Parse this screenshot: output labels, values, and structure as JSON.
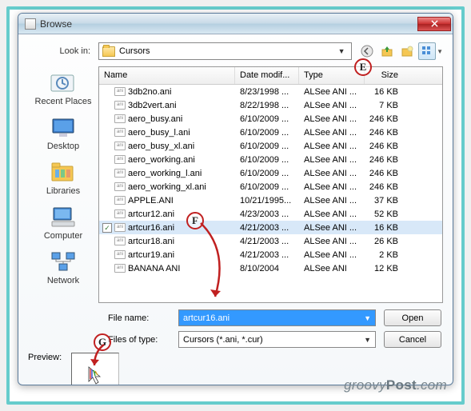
{
  "window": {
    "title": "Browse"
  },
  "lookin": {
    "label": "Look in:",
    "folder": "Cursors"
  },
  "columns": {
    "name": "Name",
    "date": "Date modif...",
    "type": "Type",
    "size": "Size"
  },
  "places": [
    {
      "id": "recent",
      "label": "Recent Places"
    },
    {
      "id": "desktop",
      "label": "Desktop"
    },
    {
      "id": "libraries",
      "label": "Libraries"
    },
    {
      "id": "computer",
      "label": "Computer"
    },
    {
      "id": "network",
      "label": "Network"
    }
  ],
  "files": [
    {
      "name": "3db2no.ani",
      "date": "8/23/1998 ...",
      "type": "ALSee ANI ...",
      "size": "16 KB",
      "sel": false
    },
    {
      "name": "3db2vert.ani",
      "date": "8/22/1998 ...",
      "type": "ALSee ANI ...",
      "size": "7 KB",
      "sel": false
    },
    {
      "name": "aero_busy.ani",
      "date": "6/10/2009 ...",
      "type": "ALSee ANI ...",
      "size": "246 KB",
      "sel": false
    },
    {
      "name": "aero_busy_l.ani",
      "date": "6/10/2009 ...",
      "type": "ALSee ANI ...",
      "size": "246 KB",
      "sel": false
    },
    {
      "name": "aero_busy_xl.ani",
      "date": "6/10/2009 ...",
      "type": "ALSee ANI ...",
      "size": "246 KB",
      "sel": false
    },
    {
      "name": "aero_working.ani",
      "date": "6/10/2009 ...",
      "type": "ALSee ANI ...",
      "size": "246 KB",
      "sel": false
    },
    {
      "name": "aero_working_l.ani",
      "date": "6/10/2009 ...",
      "type": "ALSee ANI ...",
      "size": "246 KB",
      "sel": false
    },
    {
      "name": "aero_working_xl.ani",
      "date": "6/10/2009 ...",
      "type": "ALSee ANI ...",
      "size": "246 KB",
      "sel": false
    },
    {
      "name": "APPLE.ANI",
      "date": "10/21/1995...",
      "type": "ALSee ANI ...",
      "size": "37 KB",
      "sel": false
    },
    {
      "name": "artcur12.ani",
      "date": "4/23/2003 ...",
      "type": "ALSee ANI ...",
      "size": "52 KB",
      "sel": false
    },
    {
      "name": "artcur16.ani",
      "date": "4/21/2003 ...",
      "type": "ALSee ANI ...",
      "size": "16 KB",
      "sel": true
    },
    {
      "name": "artcur18.ani",
      "date": "4/21/2003 ...",
      "type": "ALSee ANI ...",
      "size": "26 KB",
      "sel": false
    },
    {
      "name": "artcur19.ani",
      "date": "4/21/2003 ...",
      "type": "ALSee ANI ...",
      "size": "2 KB",
      "sel": false
    },
    {
      "name": "BANANA ANI",
      "date": "8/10/2004",
      "type": "ALSee ANI",
      "size": "12 KB",
      "sel": false
    }
  ],
  "filename": {
    "label": "File name:",
    "value": "artcur16.ani"
  },
  "filetype": {
    "label": "Files of type:",
    "value": "Cursors (*.ani, *.cur)"
  },
  "buttons": {
    "open": "Open",
    "cancel": "Cancel"
  },
  "preview": {
    "label": "Preview:"
  },
  "callouts": {
    "e": "E",
    "f": "F",
    "g": "G"
  },
  "watermark": {
    "a": "groovy",
    "b": "Post",
    "c": ".com"
  }
}
